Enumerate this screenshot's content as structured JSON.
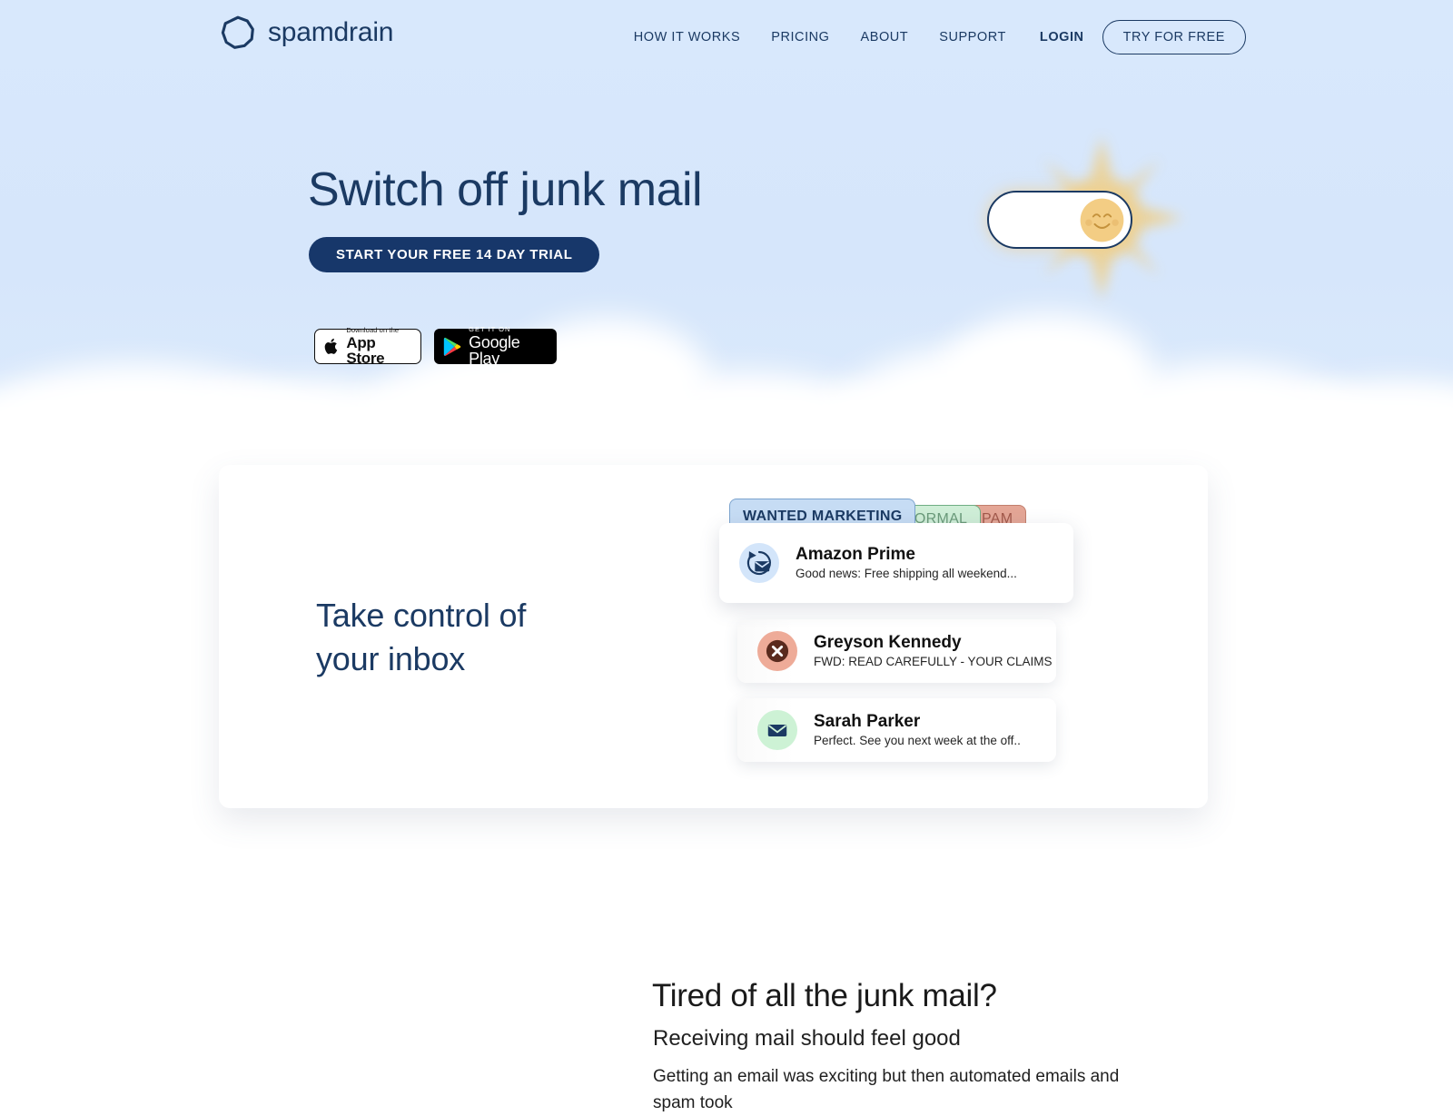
{
  "brand": {
    "name": "spamdrain",
    "logo_icon": "octagon-ring-icon",
    "navy": "#1b3a63",
    "sky": "#d7e7fb",
    "cta_navy": "#17376a"
  },
  "nav": {
    "items": [
      {
        "label": "HOW IT WORKS",
        "bold": false
      },
      {
        "label": "PRICING",
        "bold": false
      },
      {
        "label": "ABOUT",
        "bold": false
      },
      {
        "label": "SUPPORT",
        "bold": false
      },
      {
        "label": "LOGIN",
        "bold": true
      }
    ],
    "cta_label": "TRY FOR FREE"
  },
  "hero": {
    "title": "Switch off junk mail",
    "cta_label": "START YOUR FREE 14 DAY TRIAL",
    "badges": {
      "appstore": {
        "small": "Download on the",
        "big": "App Store",
        "icon": "apple-icon"
      },
      "googleplay": {
        "small": "GET IT ON",
        "big": "Google Play",
        "icon": "google-play-icon"
      }
    },
    "toggle": {
      "state": "on",
      "knob_icon": "smiling-sun-icon",
      "glow_icon": "sun-rays-icon"
    }
  },
  "panel": {
    "title_line1": "Take control of",
    "title_line2": "your inbox",
    "tabs": [
      {
        "label": "WANTED MARKETING",
        "state": "active",
        "color": "#c6dcf4"
      },
      {
        "label": "NORMAL",
        "state": "inactive",
        "color": "#cfeed7"
      },
      {
        "label": "SPAM",
        "state": "inactive",
        "color": "#e4a696"
      }
    ],
    "mails": [
      {
        "sender": "Amazon Prime",
        "preview": "Good news: Free shipping all weekend...",
        "icon": "envelope-refresh-icon",
        "avatar_color": "#d3e5fa"
      },
      {
        "sender": "Greyson Kennedy",
        "preview": "FWD: READ CAREFULLY - YOUR CLAIMS",
        "icon": "circle-x-icon",
        "avatar_color": "#eeab98"
      },
      {
        "sender": "Sarah Parker",
        "preview": "Perfect. See you next week at the off..",
        "icon": "envelope-icon",
        "avatar_color": "#cdf2d5"
      }
    ]
  },
  "bottom": {
    "heading": "Tired of all the junk mail?",
    "subheading": "Receiving mail should feel good",
    "paragraph": "Getting an email was exciting but then automated emails and spam took"
  }
}
